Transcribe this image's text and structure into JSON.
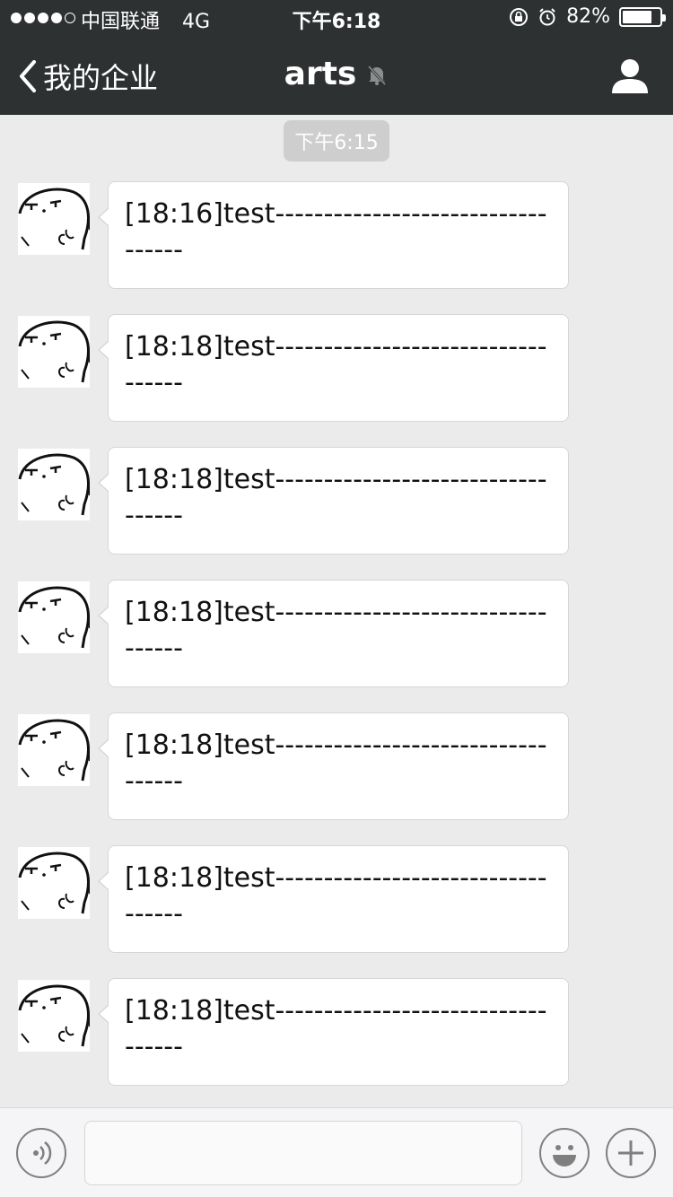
{
  "status_bar": {
    "carrier": "中国联通",
    "network": "4G",
    "time": "下午6:18",
    "battery_percent_label": "82%",
    "battery_level": 0.82
  },
  "nav": {
    "back_label": "我的企业",
    "title": "arts"
  },
  "chat": {
    "timestamp": "下午6:15",
    "messages": [
      {
        "text": "[18:16]test----------------------------------"
      },
      {
        "text": "[18:18]test----------------------------------"
      },
      {
        "text": "[18:18]test----------------------------------"
      },
      {
        "text": "[18:18]test----------------------------------"
      },
      {
        "text": "[18:18]test----------------------------------"
      },
      {
        "text": "[18:18]test----------------------------------"
      },
      {
        "text": "[18:18]test----------------------------------"
      }
    ]
  },
  "input": {
    "value": "",
    "placeholder": ""
  },
  "icons": {
    "voice": "voice-icon",
    "emoji": "emoji-icon",
    "add": "plus-icon",
    "profile": "person-icon",
    "mute": "muted-bell-icon"
  },
  "colors": {
    "nav_bg": "#2e3132",
    "chat_bg": "#ebebeb",
    "bubble_bg": "#ffffff",
    "timestamp_bg": "#cecece"
  }
}
